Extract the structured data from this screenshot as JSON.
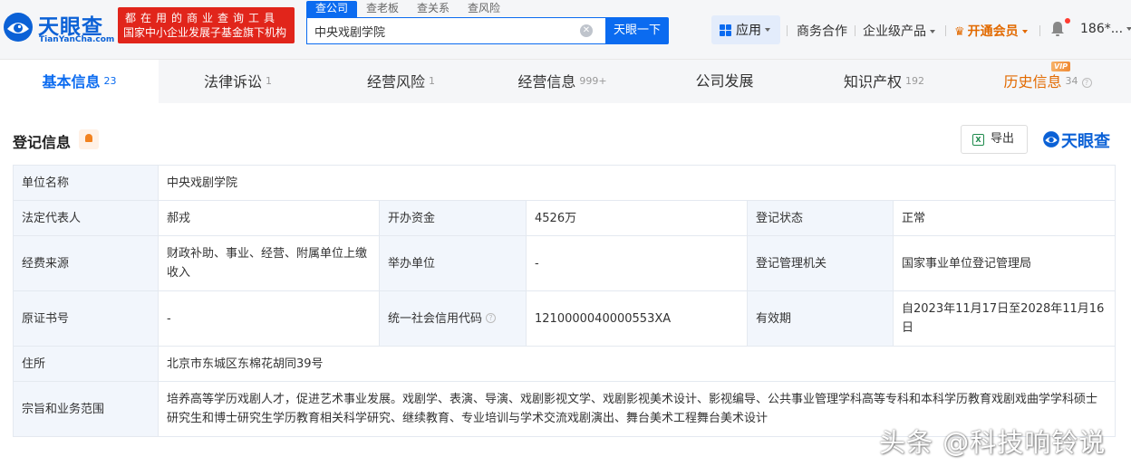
{
  "header": {
    "logo_name": "天眼查",
    "logo_domain": "TianYanCha.com",
    "slogan_line1": "都在用的商业查询工具",
    "slogan_line2": "国家中小企业发展子基金旗下机构",
    "search_tabs": [
      {
        "label": "查公司",
        "active": true
      },
      {
        "label": "查老板",
        "active": false
      },
      {
        "label": "查关系",
        "active": false
      },
      {
        "label": "查风险",
        "active": false
      }
    ],
    "search_value": "中央戏剧学院",
    "search_button": "天眼一下",
    "nav": {
      "apps": "应用",
      "business": "商务合作",
      "enterprise": "企业级产品",
      "vip": "开通会员",
      "user": "186*..."
    }
  },
  "tabs": [
    {
      "label": "基本信息",
      "count": "23",
      "active": true
    },
    {
      "label": "法律诉讼",
      "count": "1"
    },
    {
      "label": "经营风险",
      "count": "1"
    },
    {
      "label": "经营信息",
      "count": "999+"
    },
    {
      "label": "公司发展",
      "count": ""
    },
    {
      "label": "知识产权",
      "count": "192"
    },
    {
      "label": "历史信息",
      "count": "34"
    }
  ],
  "vip_badge": "VIP",
  "section": {
    "title": "登记信息",
    "export_label": "导出",
    "brand": "天眼查"
  },
  "registration": {
    "unit_name_label": "单位名称",
    "unit_name": "中央戏剧学院",
    "legal_rep_label": "法定代表人",
    "legal_rep": "郝戎",
    "capital_label": "开办资金",
    "capital": "4526万",
    "status_label": "登记状态",
    "status": "正常",
    "funding_label": "经费来源",
    "funding": "财政补助、事业、经营、附属单位上缴收入",
    "sponsor_label": "举办单位",
    "sponsor": "-",
    "authority_label": "登记管理机关",
    "authority": "国家事业单位登记管理局",
    "orig_cert_label": "原证书号",
    "orig_cert": "-",
    "credit_code_label": "统一社会信用代码",
    "credit_code": "1210000040000553XA",
    "validity_label": "有效期",
    "validity": "自2023年11月17日至2028年11月16日",
    "address_label": "住所",
    "address": "北京市东城区东棉花胡同39号",
    "scope_label": "宗旨和业务范围",
    "scope": "培养高等学历戏剧人才，促进艺术事业发展。戏剧学、表演、导演、戏剧影视文学、戏剧影视美术设计、影视编导、公共事业管理学科高等专科和本科学历教育戏剧戏曲学学科硕士研究生和博士研究生学历教育相关科学研究、继续教育、专业培训与学术交流戏剧演出、舞台美术工程舞台美术设计"
  },
  "watermark": "头条 @科技响铃说",
  "colors": {
    "brand_blue": "#0b6bf0",
    "slogan_red": "#e1251b",
    "vip_orange": "#e26a00"
  }
}
